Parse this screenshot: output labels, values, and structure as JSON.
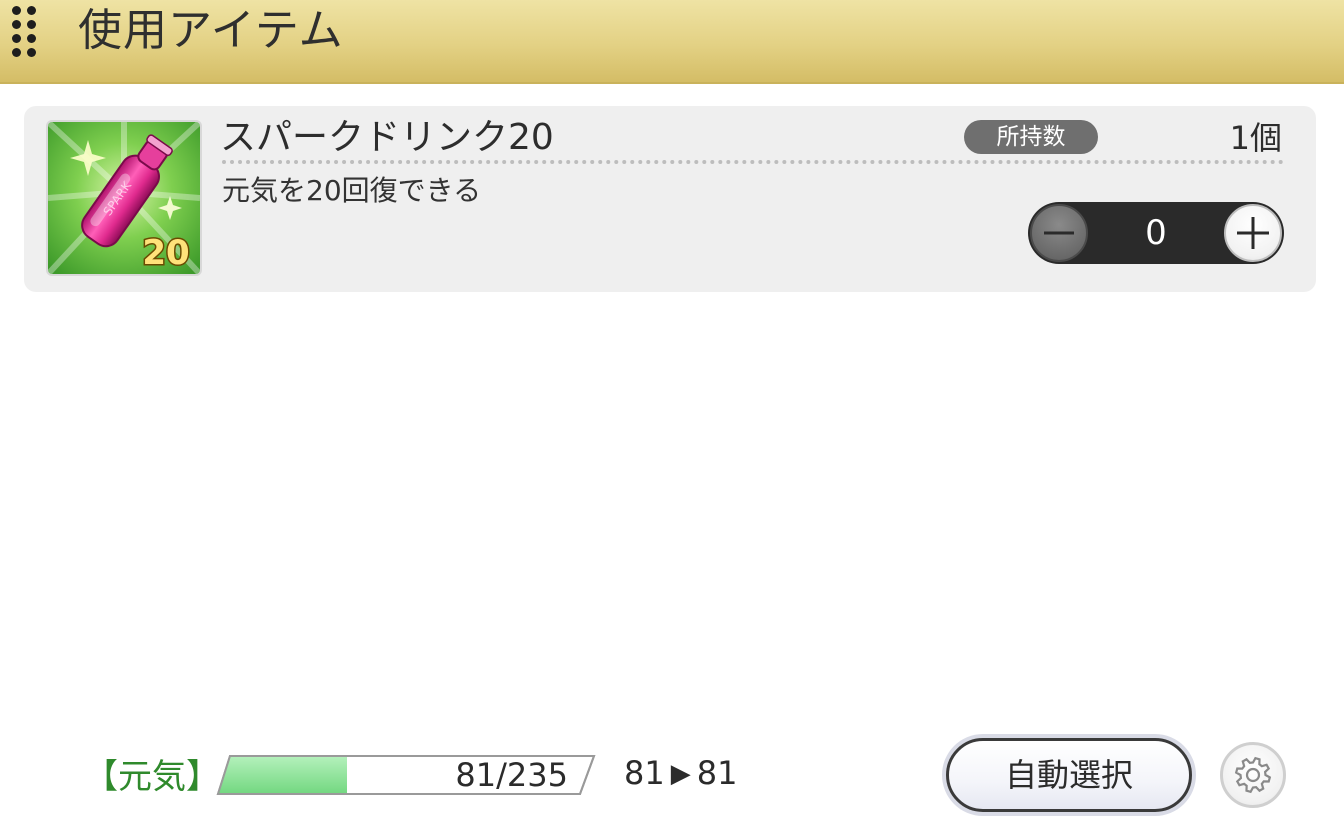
{
  "header": {
    "title": "使用アイテム",
    "grip_icon": "drag-handle-icon",
    "background_color": "#e3d184"
  },
  "item": {
    "name": "スパークドリンク20",
    "description": "元気を20回復できる",
    "owned_label": "所持数",
    "owned_count": "1個",
    "thumbnail": {
      "icon": "spark-drink-bottle-icon",
      "badge_text": "20",
      "label_text": "SPARK"
    },
    "quantity": {
      "value": "0",
      "minus_icon": "minus-icon",
      "plus_icon": "plus-icon"
    }
  },
  "stamina": {
    "label": "【元気】",
    "current": 81,
    "max": 235,
    "display": "81/235",
    "before": "81",
    "after": "81",
    "arrow": "▶",
    "fill_color": "#8ee39a"
  },
  "actions": {
    "auto_select_label": "自動選択",
    "settings_icon": "gear-icon"
  }
}
